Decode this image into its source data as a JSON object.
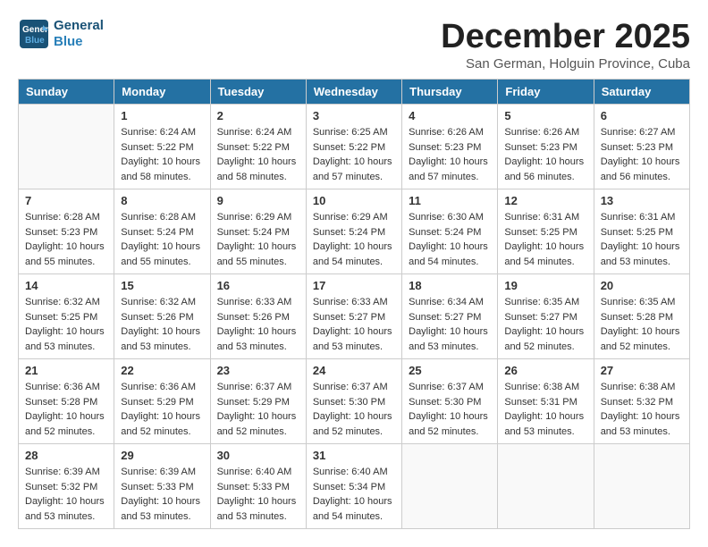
{
  "logo": {
    "line1": "General",
    "line2": "Blue"
  },
  "title": "December 2025",
  "subtitle": "San German, Holguin Province, Cuba",
  "days_of_week": [
    "Sunday",
    "Monday",
    "Tuesday",
    "Wednesday",
    "Thursday",
    "Friday",
    "Saturday"
  ],
  "weeks": [
    [
      {
        "day": "",
        "info": ""
      },
      {
        "day": "1",
        "info": "Sunrise: 6:24 AM\nSunset: 5:22 PM\nDaylight: 10 hours\nand 58 minutes."
      },
      {
        "day": "2",
        "info": "Sunrise: 6:24 AM\nSunset: 5:22 PM\nDaylight: 10 hours\nand 58 minutes."
      },
      {
        "day": "3",
        "info": "Sunrise: 6:25 AM\nSunset: 5:22 PM\nDaylight: 10 hours\nand 57 minutes."
      },
      {
        "day": "4",
        "info": "Sunrise: 6:26 AM\nSunset: 5:23 PM\nDaylight: 10 hours\nand 57 minutes."
      },
      {
        "day": "5",
        "info": "Sunrise: 6:26 AM\nSunset: 5:23 PM\nDaylight: 10 hours\nand 56 minutes."
      },
      {
        "day": "6",
        "info": "Sunrise: 6:27 AM\nSunset: 5:23 PM\nDaylight: 10 hours\nand 56 minutes."
      }
    ],
    [
      {
        "day": "7",
        "info": "Sunrise: 6:28 AM\nSunset: 5:23 PM\nDaylight: 10 hours\nand 55 minutes."
      },
      {
        "day": "8",
        "info": "Sunrise: 6:28 AM\nSunset: 5:24 PM\nDaylight: 10 hours\nand 55 minutes."
      },
      {
        "day": "9",
        "info": "Sunrise: 6:29 AM\nSunset: 5:24 PM\nDaylight: 10 hours\nand 55 minutes."
      },
      {
        "day": "10",
        "info": "Sunrise: 6:29 AM\nSunset: 5:24 PM\nDaylight: 10 hours\nand 54 minutes."
      },
      {
        "day": "11",
        "info": "Sunrise: 6:30 AM\nSunset: 5:24 PM\nDaylight: 10 hours\nand 54 minutes."
      },
      {
        "day": "12",
        "info": "Sunrise: 6:31 AM\nSunset: 5:25 PM\nDaylight: 10 hours\nand 54 minutes."
      },
      {
        "day": "13",
        "info": "Sunrise: 6:31 AM\nSunset: 5:25 PM\nDaylight: 10 hours\nand 53 minutes."
      }
    ],
    [
      {
        "day": "14",
        "info": "Sunrise: 6:32 AM\nSunset: 5:25 PM\nDaylight: 10 hours\nand 53 minutes."
      },
      {
        "day": "15",
        "info": "Sunrise: 6:32 AM\nSunset: 5:26 PM\nDaylight: 10 hours\nand 53 minutes."
      },
      {
        "day": "16",
        "info": "Sunrise: 6:33 AM\nSunset: 5:26 PM\nDaylight: 10 hours\nand 53 minutes."
      },
      {
        "day": "17",
        "info": "Sunrise: 6:33 AM\nSunset: 5:27 PM\nDaylight: 10 hours\nand 53 minutes."
      },
      {
        "day": "18",
        "info": "Sunrise: 6:34 AM\nSunset: 5:27 PM\nDaylight: 10 hours\nand 53 minutes."
      },
      {
        "day": "19",
        "info": "Sunrise: 6:35 AM\nSunset: 5:27 PM\nDaylight: 10 hours\nand 52 minutes."
      },
      {
        "day": "20",
        "info": "Sunrise: 6:35 AM\nSunset: 5:28 PM\nDaylight: 10 hours\nand 52 minutes."
      }
    ],
    [
      {
        "day": "21",
        "info": "Sunrise: 6:36 AM\nSunset: 5:28 PM\nDaylight: 10 hours\nand 52 minutes."
      },
      {
        "day": "22",
        "info": "Sunrise: 6:36 AM\nSunset: 5:29 PM\nDaylight: 10 hours\nand 52 minutes."
      },
      {
        "day": "23",
        "info": "Sunrise: 6:37 AM\nSunset: 5:29 PM\nDaylight: 10 hours\nand 52 minutes."
      },
      {
        "day": "24",
        "info": "Sunrise: 6:37 AM\nSunset: 5:30 PM\nDaylight: 10 hours\nand 52 minutes."
      },
      {
        "day": "25",
        "info": "Sunrise: 6:37 AM\nSunset: 5:30 PM\nDaylight: 10 hours\nand 52 minutes."
      },
      {
        "day": "26",
        "info": "Sunrise: 6:38 AM\nSunset: 5:31 PM\nDaylight: 10 hours\nand 53 minutes."
      },
      {
        "day": "27",
        "info": "Sunrise: 6:38 AM\nSunset: 5:32 PM\nDaylight: 10 hours\nand 53 minutes."
      }
    ],
    [
      {
        "day": "28",
        "info": "Sunrise: 6:39 AM\nSunset: 5:32 PM\nDaylight: 10 hours\nand 53 minutes."
      },
      {
        "day": "29",
        "info": "Sunrise: 6:39 AM\nSunset: 5:33 PM\nDaylight: 10 hours\nand 53 minutes."
      },
      {
        "day": "30",
        "info": "Sunrise: 6:40 AM\nSunset: 5:33 PM\nDaylight: 10 hours\nand 53 minutes."
      },
      {
        "day": "31",
        "info": "Sunrise: 6:40 AM\nSunset: 5:34 PM\nDaylight: 10 hours\nand 54 minutes."
      },
      {
        "day": "",
        "info": ""
      },
      {
        "day": "",
        "info": ""
      },
      {
        "day": "",
        "info": ""
      }
    ]
  ]
}
